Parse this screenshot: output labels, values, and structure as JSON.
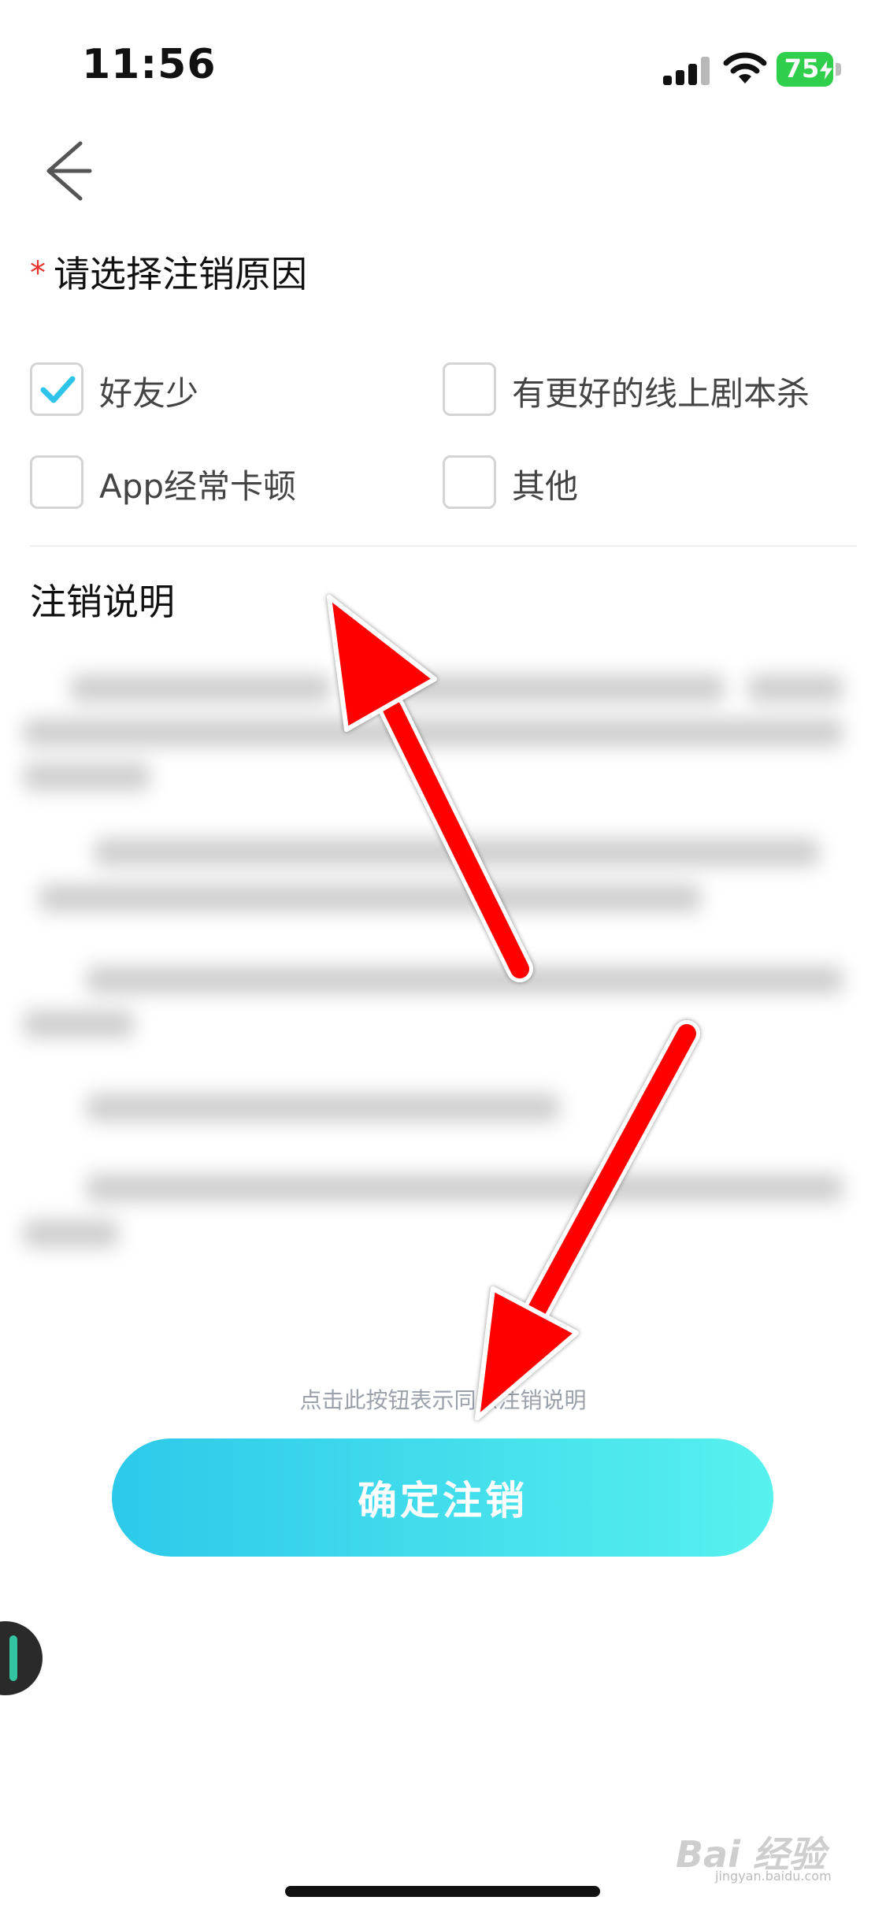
{
  "status_bar": {
    "time": "11:56",
    "battery": "75"
  },
  "form": {
    "required_mark": "*",
    "title": "请选择注销原因",
    "options": [
      {
        "label": "好友少",
        "checked": true
      },
      {
        "label": "有更好的线上剧本杀",
        "checked": false
      },
      {
        "label": "App经常卡顿",
        "checked": false
      },
      {
        "label": "其他",
        "checked": false
      }
    ]
  },
  "notes": {
    "title": "注销说明"
  },
  "footer": {
    "hint": "点击此按钮表示同意注销说明",
    "confirm_label": "确定注销"
  },
  "watermark": {
    "text": "Bai 经验",
    "sub": "jingyan.baidu.com"
  },
  "colors": {
    "accent_check": "#2ec4ea",
    "button_start": "#2dc9ea",
    "button_end": "#57f1ee",
    "required": "#e8302c",
    "annotation_arrow": "#ff0000"
  }
}
